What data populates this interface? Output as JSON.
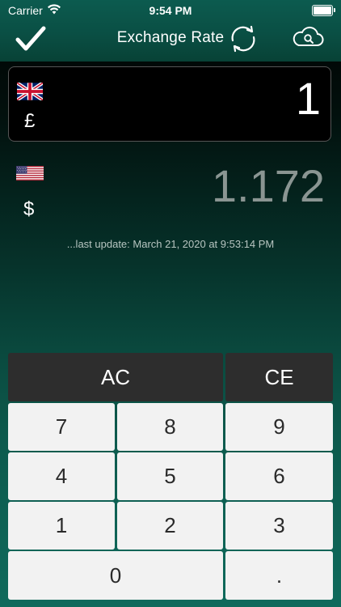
{
  "status_bar": {
    "carrier": "Carrier",
    "time": "9:54 PM",
    "wifi_icon": "wifi-icon",
    "battery_icon": "battery-icon"
  },
  "nav": {
    "title": "Exchange Rate",
    "done_icon": "checkmark-icon",
    "refresh_icon": "refresh-icon",
    "cloud_icon": "cloud-search-icon"
  },
  "source": {
    "flag": "uk-flag-icon",
    "symbol": "£",
    "value": "1"
  },
  "target": {
    "flag": "us-flag-icon",
    "symbol": "$",
    "value": "1.172"
  },
  "last_update": "...last update:  March 21, 2020 at 9:53:14 PM",
  "keypad": {
    "ac": "AC",
    "ce": "CE",
    "k7": "7",
    "k8": "8",
    "k9": "9",
    "k4": "4",
    "k5": "5",
    "k6": "6",
    "k1": "1",
    "k2": "2",
    "k3": "3",
    "k0": "0",
    "dot": "."
  },
  "colors": {
    "accent_green": "#0a4f44",
    "key_dark": "#2d2d2d",
    "key_light": "#f2f2f2",
    "converted_text": "#8a9592"
  }
}
